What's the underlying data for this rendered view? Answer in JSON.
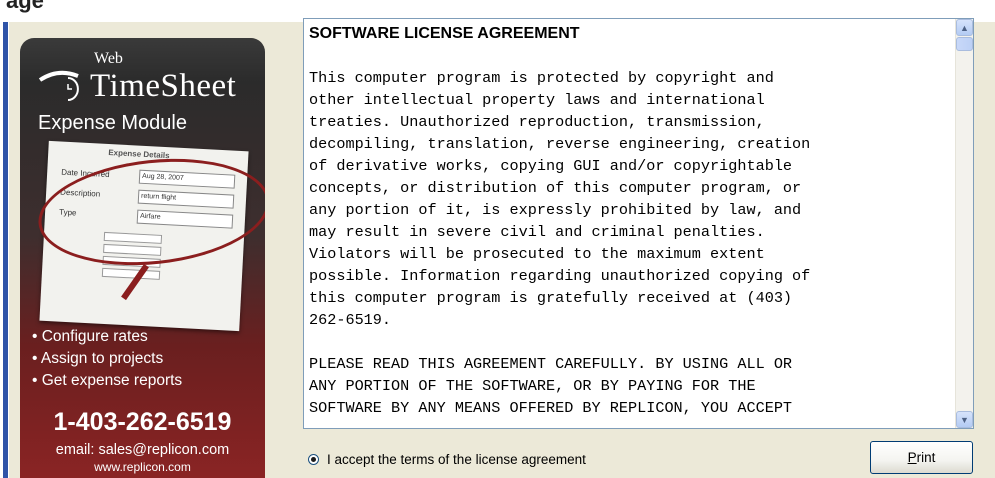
{
  "header": {
    "clipped_title": "age"
  },
  "banner": {
    "logo_prefix": "Web",
    "logo_name": "TimeSheet",
    "module_title": "Expense Module",
    "screenshot": {
      "title": "Expense Details",
      "rows": [
        {
          "label": "Date Incurred",
          "value": "Aug 28, 2007"
        },
        {
          "label": "Description",
          "value": "return flight"
        },
        {
          "label": "Type",
          "value": "Airfare"
        }
      ]
    },
    "bullets": [
      "• Configure rates",
      "• Assign to projects",
      "• Get expense reports"
    ],
    "phone": "1-403-262-6519",
    "email": "email: sales@replicon.com",
    "website": "www.replicon.com",
    "colors": {
      "accent_red": "#8b1e1e",
      "dark": "#2b2b2b"
    }
  },
  "license": {
    "title": "SOFTWARE LICENSE AGREEMENT",
    "lines": [
      "This computer program is protected by copyright and",
      "other intellectual property laws and international",
      "treaties. Unauthorized reproduction, transmission,",
      "decompiling, translation, reverse engineering, creation",
      "of derivative works, copying GUI and/or copyrightable",
      "concepts, or distribution of this computer program, or",
      "any portion of it, is expressly prohibited by law, and",
      "may result in severe civil and criminal penalties.",
      "Violators will be prosecuted to the maximum extent",
      "possible. Information regarding unauthorized copying of",
      "this computer program is gratefully received at (403)",
      "262-6519.",
      "",
      "PLEASE READ THIS AGREEMENT CAREFULLY. BY USING ALL OR",
      "ANY PORTION OF THE SOFTWARE, OR BY PAYING FOR THE",
      "SOFTWARE BY ANY MEANS OFFERED BY REPLICON, YOU ACCEPT"
    ],
    "scroll_up_icon": "chevron-up-icon",
    "scroll_down_icon": "chevron-down-icon"
  },
  "accept_label": "I accept the terms of the license agreement",
  "accept_selected": true,
  "print": {
    "prefix": "",
    "mnemonic": "P",
    "suffix": "rint"
  }
}
